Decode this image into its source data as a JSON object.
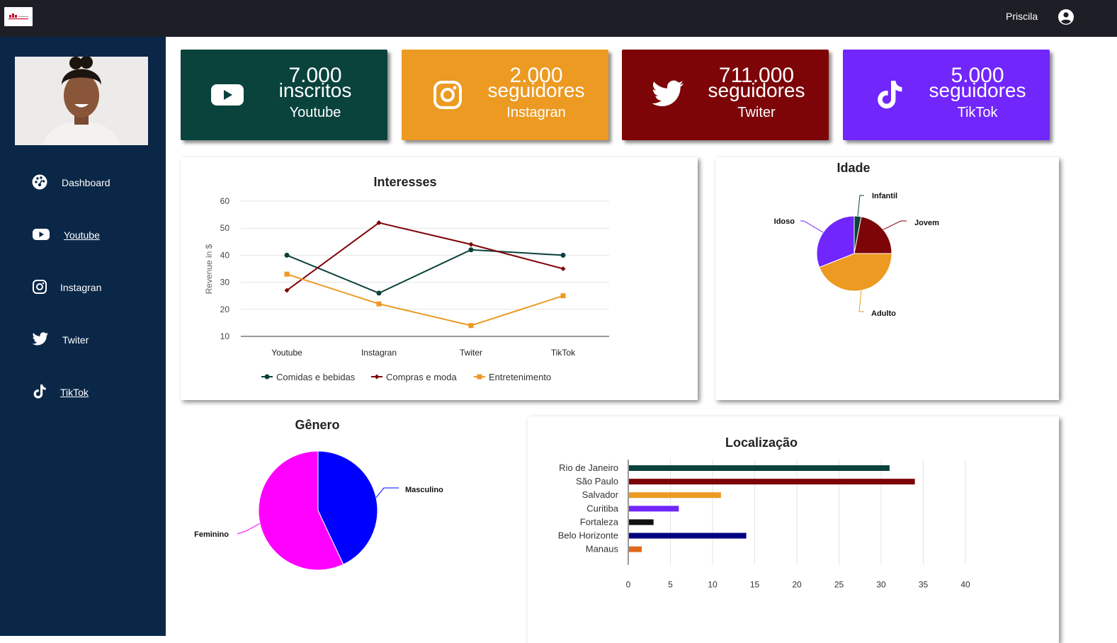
{
  "header": {
    "username": "Priscila",
    "user_icon": "account-circle-icon",
    "logo_icon": "brand-logo-icon"
  },
  "sidebar": {
    "profile_photo": "profile-photo",
    "items": [
      {
        "label": "Dashboard",
        "icon": "dashboard-icon"
      },
      {
        "label": "Youtube",
        "icon": "youtube-icon"
      },
      {
        "label": "Instagran",
        "icon": "instagram-icon"
      },
      {
        "label": "Twiter",
        "icon": "twitter-icon"
      },
      {
        "label": "TikTok",
        "icon": "tiktok-icon"
      }
    ]
  },
  "cards": [
    {
      "value": "7.000",
      "unit": "inscritos",
      "platform": "Youtube",
      "color": "#0a423c",
      "icon": "youtube-icon"
    },
    {
      "value": "2.000",
      "unit": "seguidores",
      "platform": "Instagran",
      "color": "#ec9a22",
      "icon": "instagram-icon"
    },
    {
      "value": "711.000",
      "unit": "seguidores",
      "platform": "Twiter",
      "color": "#7d0508",
      "icon": "twitter-icon"
    },
    {
      "value": "5.000",
      "unit": "seguidores",
      "platform": "TikTok",
      "color": "#7126fc",
      "icon": "tiktok-icon"
    }
  ],
  "chart_data": [
    {
      "type": "line",
      "title": "Interesses",
      "ylabel": "Revenue in $",
      "xlabel": "",
      "categories": [
        "Youtube",
        "Instagran",
        "Twiter",
        "TikTok"
      ],
      "yticks": [
        10,
        20,
        30,
        40,
        50,
        60
      ],
      "ylim": [
        10,
        60
      ],
      "grid": true,
      "legend_position": "bottom",
      "series": [
        {
          "name": "Comidas e bebidas",
          "values": [
            40,
            26,
            42,
            40
          ],
          "color": "#0a423c",
          "marker": "circle"
        },
        {
          "name": "Compras e moda",
          "values": [
            27,
            52,
            44,
            35
          ],
          "color": "#7d0508",
          "marker": "diamond"
        },
        {
          "name": "Entretenimento",
          "values": [
            33,
            22,
            14,
            25
          ],
          "color": "#ec9a22",
          "marker": "square"
        }
      ]
    },
    {
      "type": "pie",
      "title": "Idade",
      "labels": [
        "Infantil",
        "Jovem",
        "Adulto",
        "Idoso"
      ],
      "values": [
        3,
        22,
        44,
        31
      ],
      "colors": [
        "#0a423c",
        "#7d0508",
        "#ec9a22",
        "#7126fc"
      ]
    },
    {
      "type": "pie",
      "title": "Gênero",
      "labels": [
        "Masculino",
        "Feminino"
      ],
      "values": [
        43,
        57
      ],
      "colors": [
        "#0000ff",
        "#ff00ff"
      ]
    },
    {
      "type": "bar",
      "orientation": "horizontal",
      "title": "Localização",
      "categories": [
        "Rio de Janeiro",
        "São Paulo",
        "Salvador",
        "Curitiba",
        "Fortaleza",
        "Belo Horizonte",
        "Manaus"
      ],
      "values": [
        31,
        34,
        11,
        6,
        3,
        14,
        1.6
      ],
      "colors": [
        "#0a423c",
        "#7d0508",
        "#ec9a22",
        "#7126fc",
        "#111111",
        "#000080",
        "#e06a1a"
      ],
      "xticks": [
        0,
        5,
        10,
        15,
        20,
        25,
        30,
        35,
        40
      ],
      "xlim": [
        0,
        40
      ],
      "grid": true
    }
  ]
}
